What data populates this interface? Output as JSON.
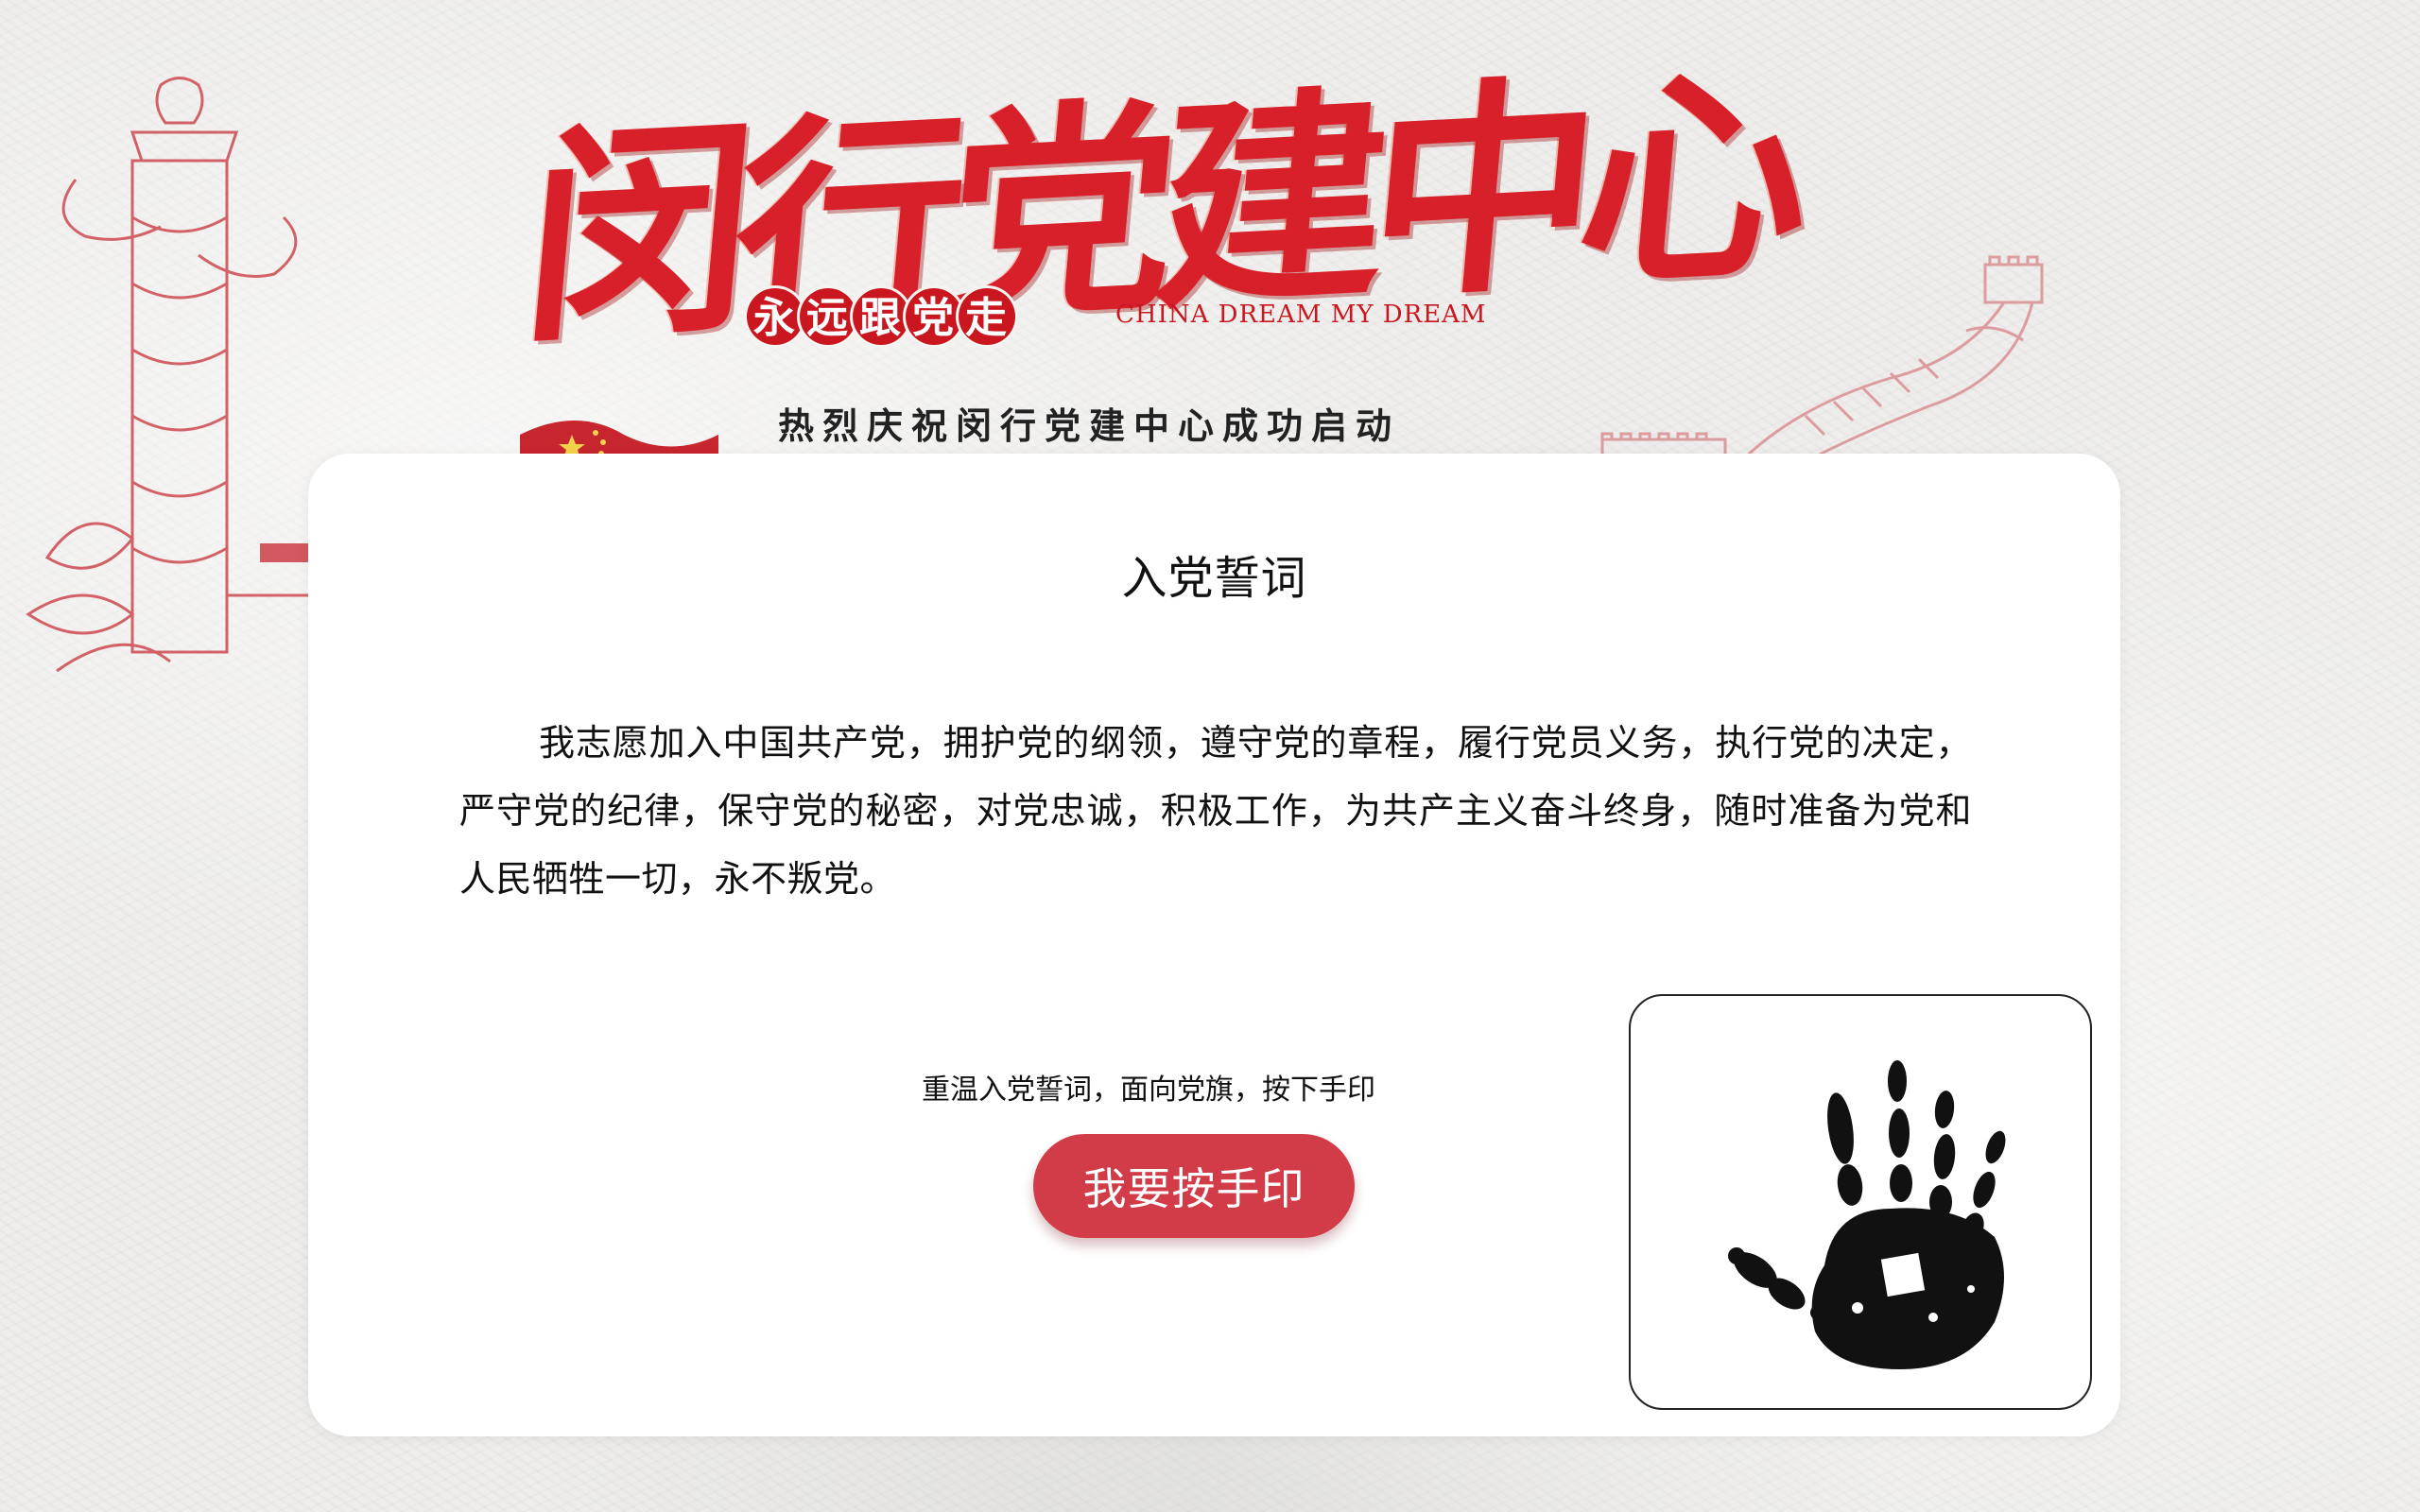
{
  "header": {
    "title": "闵行党建中心",
    "badge": "永远跟党走",
    "slogan_en": "CHINA DREAM  MY DREAM",
    "subtitle": "热烈庆祝闵行党建中心成功启动"
  },
  "card": {
    "title": "入党誓词",
    "oath": "我志愿加入中国共产党，拥护党的纲领，遵守党的章程，履行党员义务，执行党的决定，严守党的纪律，保守党的秘密，对党忠诚，积极工作，为共产主义奋斗终身，随时准备为党和人民牺牲一切，永不叛党。",
    "hint": "重温入党誓词，面向党旗，按下手印",
    "button_label": "我要按手印"
  },
  "icons": {
    "handprint": "handprint-icon",
    "pillar": "huabiao-pillar-icon",
    "great_wall": "great-wall-icon",
    "flag": "red-flag-icon"
  },
  "colors": {
    "accent_red": "#d8202a",
    "button_red": "#d23c48",
    "background": "#eeedeb",
    "card": "#ffffff"
  }
}
